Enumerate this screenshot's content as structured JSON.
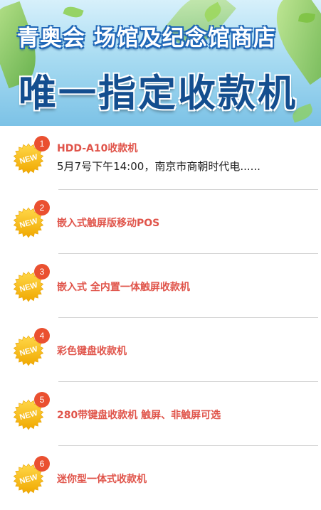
{
  "banner": {
    "line1": "青奥会 场馆及纪念馆商店",
    "line2": "唯一指定收款机"
  },
  "badge_text": "NEW",
  "items": [
    {
      "number": "1",
      "title": "HDD-A10收款机",
      "desc": "5月7号下午14:00，南京市商朝时代电......"
    },
    {
      "number": "2",
      "title": "嵌入式触屏版移动POS",
      "desc": ""
    },
    {
      "number": "3",
      "title": "嵌入式 全内置一体触屏收款机",
      "desc": ""
    },
    {
      "number": "4",
      "title": "彩色键盘收款机",
      "desc": ""
    },
    {
      "number": "5",
      "title": "280带键盘收款机 触屏、非触屏可选",
      "desc": ""
    },
    {
      "number": "6",
      "title": "迷你型一体式收款机",
      "desc": ""
    }
  ],
  "colors": {
    "title": "#e0544a",
    "number_badge": "#ea5030",
    "burst": "#f5b800",
    "banner_text": "#144e8f"
  }
}
